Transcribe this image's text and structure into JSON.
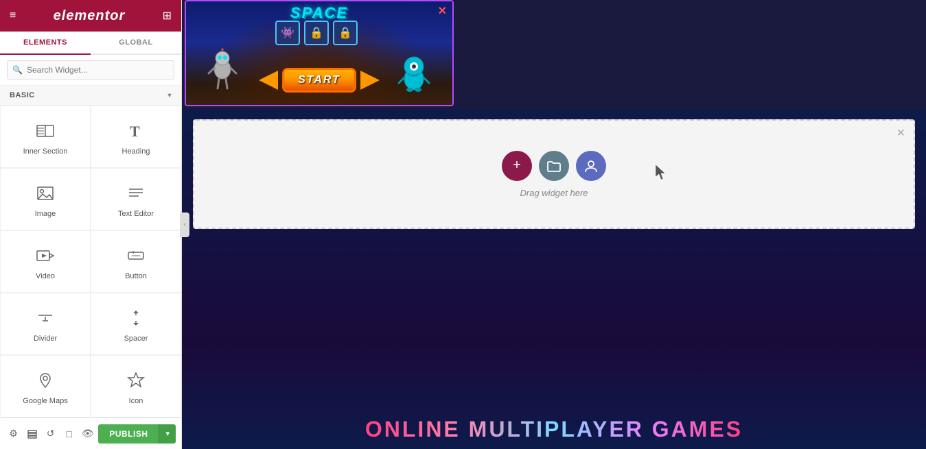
{
  "header": {
    "logo": "elementor",
    "hamburger_icon": "≡",
    "grid_icon": "⊞"
  },
  "tabs": {
    "elements_label": "ELEMENTS",
    "global_label": "GLOBAL",
    "active": "elements"
  },
  "search": {
    "placeholder": "Search Widget...",
    "icon": "🔍"
  },
  "section": {
    "label": "BASIC",
    "chevron": "▾"
  },
  "widgets": [
    {
      "id": "inner-section",
      "label": "Inner Section",
      "icon": "inner_section"
    },
    {
      "id": "heading",
      "label": "Heading",
      "icon": "heading"
    },
    {
      "id": "image",
      "label": "Image",
      "icon": "image"
    },
    {
      "id": "text-editor",
      "label": "Text Editor",
      "icon": "text_editor"
    },
    {
      "id": "video",
      "label": "Video",
      "icon": "video"
    },
    {
      "id": "button",
      "label": "Button",
      "icon": "button"
    },
    {
      "id": "divider",
      "label": "Divider",
      "icon": "divider"
    },
    {
      "id": "spacer",
      "label": "Spacer",
      "icon": "spacer"
    },
    {
      "id": "google-maps",
      "label": "Google Maps",
      "icon": "google_maps"
    },
    {
      "id": "icon",
      "label": "Icon",
      "icon": "icon_widget"
    }
  ],
  "bottom_toolbar": {
    "settings_icon": "⚙",
    "layers_icon": "◈",
    "history_icon": "↺",
    "responsive_icon": "□",
    "eye_icon": "👁",
    "publish_label": "PUBLISH",
    "publish_arrow": "▾"
  },
  "canvas": {
    "game_title": "SPACE",
    "close_icon": "✕",
    "drop_text": "Drag widget here",
    "bottom_text": "ONLINE MULTIPLAYER GAMES",
    "collapse_arrow": "‹"
  }
}
